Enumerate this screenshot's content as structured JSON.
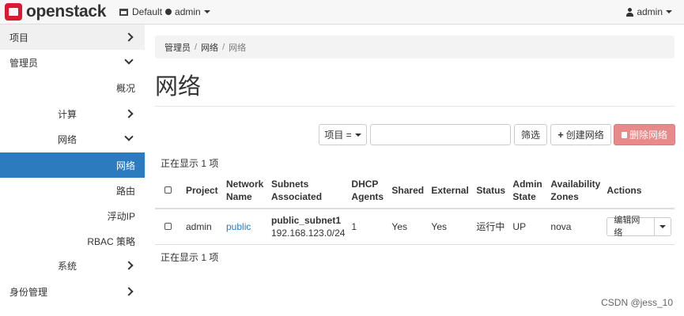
{
  "brand": {
    "logo_text": "openstack",
    "accent": "#da1a32"
  },
  "topbar": {
    "domain": "Default",
    "project": "admin",
    "user": "admin"
  },
  "sidebar": {
    "items": [
      {
        "label": "项目",
        "icon": "chevron-right-icon"
      },
      {
        "label": "管理员",
        "icon": "chevron-down-icon"
      },
      {
        "label": "概况"
      },
      {
        "label": "计算",
        "icon": "chevron-right-icon"
      },
      {
        "label": "网络",
        "icon": "chevron-down-icon"
      },
      {
        "label": "网络",
        "active": true
      },
      {
        "label": "路由"
      },
      {
        "label": "浮动IP"
      },
      {
        "label": "RBAC 策略"
      },
      {
        "label": "系统",
        "icon": "chevron-right-icon"
      },
      {
        "label": "身份管理",
        "icon": "chevron-right-icon"
      }
    ],
    "active_color": "#2c7bbf"
  },
  "breadcrumb": [
    "管理员",
    "网络",
    "网络"
  ],
  "page_title": "网络",
  "toolbar": {
    "filter_select": "项目 =",
    "filter_value": "",
    "filter_button": "筛选",
    "create_button": "创建网络",
    "delete_button": "删除网络"
  },
  "count_text_top": "正在显示 1 项",
  "count_text_bottom": "正在显示 1 项",
  "table": {
    "headers": [
      "Project",
      "Network Name",
      "Subnets Associated",
      "DHCP Agents",
      "Shared",
      "External",
      "Status",
      "Admin State",
      "Availability Zones",
      "Actions"
    ],
    "header_lines": {
      "network_name": [
        "Network",
        "Name"
      ],
      "subnets": [
        "Subnets",
        "Associated"
      ],
      "dhcp": [
        "DHCP",
        "Agents"
      ],
      "admin_state": [
        "Admin",
        "State"
      ],
      "zones": [
        "Availability",
        "Zones"
      ]
    },
    "rows": [
      {
        "project": "admin",
        "network_name": "public",
        "subnet_name": "public_subnet1",
        "subnet_cidr": "192.168.123.0/24",
        "dhcp_agents": "1",
        "shared": "Yes",
        "external": "Yes",
        "status": "运行中",
        "admin_state": "UP",
        "zones": "nova",
        "action": "编辑网络"
      }
    ]
  },
  "watermark": "CSDN @jess_10"
}
